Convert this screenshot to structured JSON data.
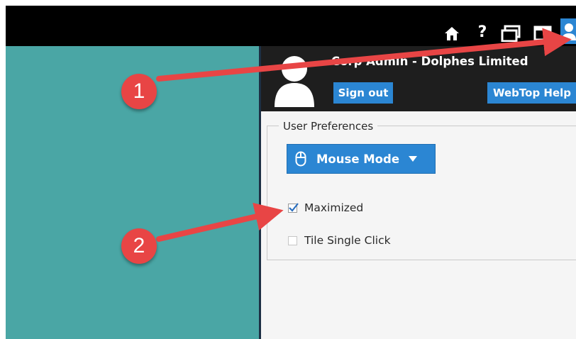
{
  "topbar": {
    "icons": [
      "home-icon",
      "help-icon",
      "window-stack-icon",
      "window-icon",
      "user-icon"
    ]
  },
  "user_panel": {
    "name": "Corp Admin - Dolphes Limited",
    "sign_out_label": "Sign out",
    "webtop_help_label": "WebTop Help"
  },
  "preferences": {
    "legend": "User Preferences",
    "mouse_mode_label": "Mouse Mode",
    "maximized_label": "Maximized",
    "maximized_checked": true,
    "tile_single_click_label": "Tile Single Click",
    "tile_single_click_checked": false
  },
  "callouts": [
    {
      "number": "1",
      "label": "1"
    },
    {
      "number": "2",
      "label": "2"
    }
  ],
  "colors": {
    "teal": "#4aa6a5",
    "accent_blue": "#2b86d3",
    "callout_red": "#e84545",
    "topbar": "#000000",
    "panel_header": "#1e1e1e"
  }
}
